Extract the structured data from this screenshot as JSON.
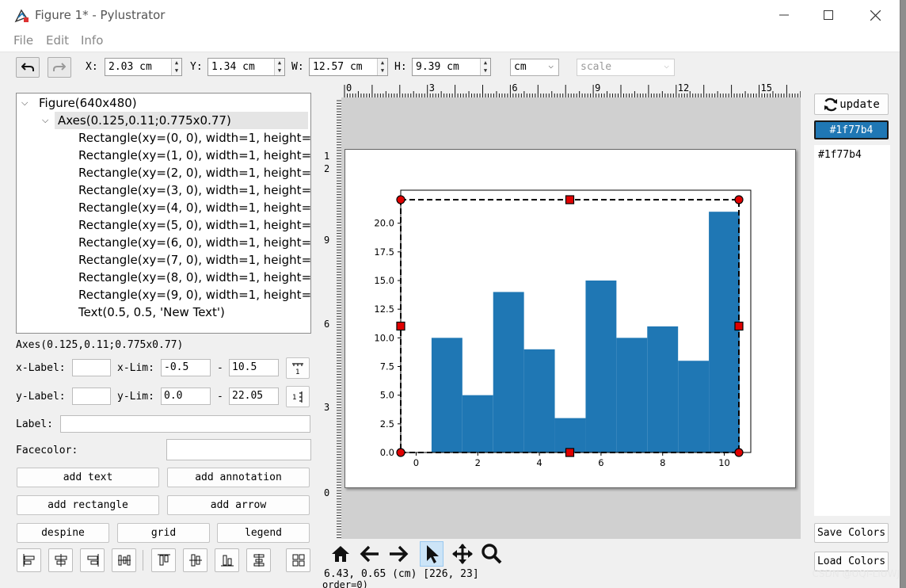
{
  "window": {
    "title": "Figure 1* - Pylustrator",
    "minimize_icon": "minimize-icon",
    "maximize_icon": "maximize-icon",
    "close_icon": "close-icon"
  },
  "menu": {
    "items": [
      "File",
      "Edit",
      "Info"
    ]
  },
  "toolbar": {
    "x_label": "X:",
    "x_value": "2.03 cm",
    "y_label": "Y:",
    "y_value": "1.34 cm",
    "w_label": "W:",
    "w_value": "12.57 cm",
    "h_label": "H:",
    "h_value": "9.39 cm",
    "unit_value": "cm",
    "scale_value": "scale"
  },
  "tree": {
    "root": "Figure(640x480)",
    "axes": "Axes(0.125,0.11;0.775x0.77)",
    "children": [
      "Rectangle(xy=(0, 0), width=1, height=...",
      "Rectangle(xy=(1, 0), width=1, height=...",
      "Rectangle(xy=(2, 0), width=1, height=...",
      "Rectangle(xy=(3, 0), width=1, height=...",
      "Rectangle(xy=(4, 0), width=1, height=...",
      "Rectangle(xy=(5, 0), width=1, height=...",
      "Rectangle(xy=(6, 0), width=1, height=...",
      "Rectangle(xy=(7, 0), width=1, height=...",
      "Rectangle(xy=(8, 0), width=1, height=...",
      "Rectangle(xy=(9, 0), width=1, height=...",
      "Text(0.5, 0.5, 'New Text')"
    ]
  },
  "props": {
    "selected": "Axes(0.125,0.11;0.775x0.77)",
    "xlabel_label": "x-Label:",
    "xlabel_value": "",
    "xlim_label": "x-Lim:",
    "xlim_min": "-0.5",
    "xlim_max": "10.5",
    "ylabel_label": "y-Label:",
    "ylabel_value": "",
    "ylim_label": "y-Lim:",
    "ylim_min": "0.0",
    "ylim_max": "22.05",
    "dash": "-",
    "label_label": "Label:",
    "label_value": "",
    "facecolor_label": "Facecolor:"
  },
  "buttons": {
    "add_text": "add text",
    "add_annotation": "add annotation",
    "add_rectangle": "add rectangle",
    "add_arrow": "add arrow",
    "despine": "despine",
    "grid": "grid",
    "legend": "legend"
  },
  "rulers": {
    "top_ticks": [
      "0",
      "3",
      "6",
      "9",
      "12",
      "15"
    ],
    "left_ticks": [
      "1",
      "2",
      "9",
      "6",
      "3",
      "0"
    ]
  },
  "chart_data": {
    "type": "bar",
    "x": [
      0,
      1,
      2,
      3,
      4,
      5,
      6,
      7,
      8,
      9,
      10
    ],
    "values": [
      10,
      5,
      14,
      9,
      3,
      15,
      10,
      11,
      8,
      21
    ],
    "bar_starts": [
      0.5,
      1.5,
      2.5,
      3.5,
      4.5,
      5.5,
      6.5,
      7.5,
      8.5,
      9.5
    ],
    "bar_width": 1,
    "xlim": [
      -0.5,
      10.5
    ],
    "ylim": [
      0.0,
      22.05
    ],
    "xticks": [
      "0",
      "2",
      "4",
      "6",
      "8",
      "10"
    ],
    "yticks": [
      "0.0",
      "2.5",
      "5.0",
      "7.5",
      "10.0",
      "12.5",
      "15.0",
      "17.5",
      "20.0"
    ],
    "color": "#1f77b4",
    "grid": false
  },
  "status": {
    "coords": "6.43, 0.65 (cm) [226, 23]",
    "cut_text": "order=0)"
  },
  "right_panel": {
    "update_label": "update",
    "swatch_value": "#1f77b4",
    "color_list": [
      "#1f77b4"
    ],
    "save_colors": "Save Colors",
    "load_colors": "Load Colors"
  },
  "watermark": "CSDN @UQI-LIUWJ",
  "colors": {
    "accent": "#1f77b4",
    "handle": "#e00000",
    "selection": "#e5e5e5"
  }
}
